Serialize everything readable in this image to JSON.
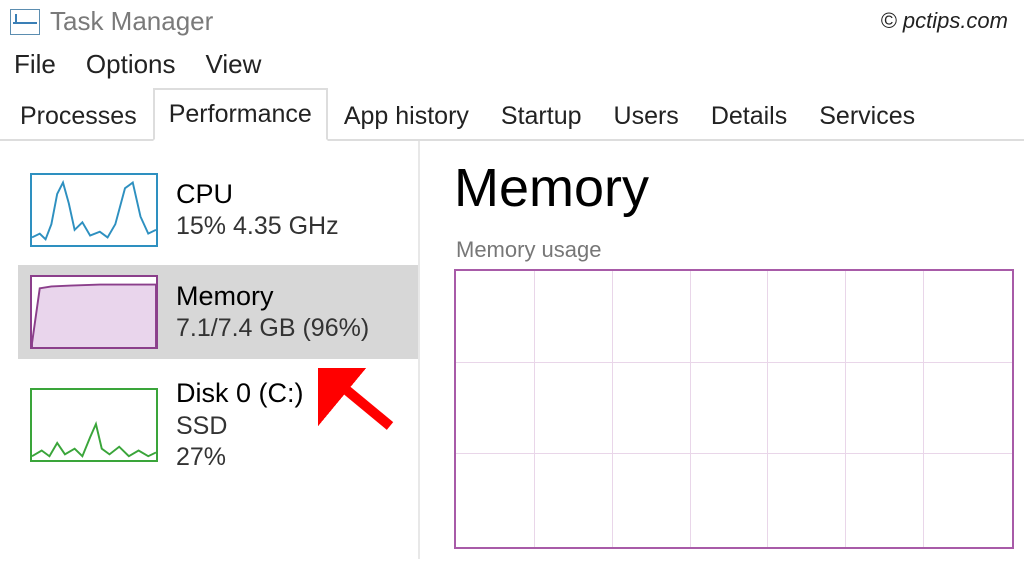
{
  "watermark": "© pctips.com",
  "title": "Task Manager",
  "menu": [
    "File",
    "Options",
    "View"
  ],
  "tabs": [
    "Processes",
    "Performance",
    "App history",
    "Startup",
    "Users",
    "Details",
    "Services"
  ],
  "active_tab_index": 1,
  "sidebar": {
    "items": [
      {
        "name": "CPU",
        "sub": "15% 4.35 GHz",
        "color": "#2e90c0"
      },
      {
        "name": "Memory",
        "sub": "7.1/7.4 GB (96%)",
        "color": "#8b3f8b"
      },
      {
        "name": "Disk 0 (C:)",
        "sub1": "SSD",
        "sub2": "27%",
        "color": "#3aa53a"
      }
    ],
    "selected_index": 1
  },
  "main": {
    "title": "Memory",
    "chart_label": "Memory usage"
  },
  "chart_data": {
    "type": "line",
    "title": "Memory usage",
    "xlabel": "",
    "ylabel": "",
    "series": [
      {
        "name": "Memory",
        "values": []
      }
    ],
    "note": "chart area visible but no plotted data shown in crop"
  }
}
